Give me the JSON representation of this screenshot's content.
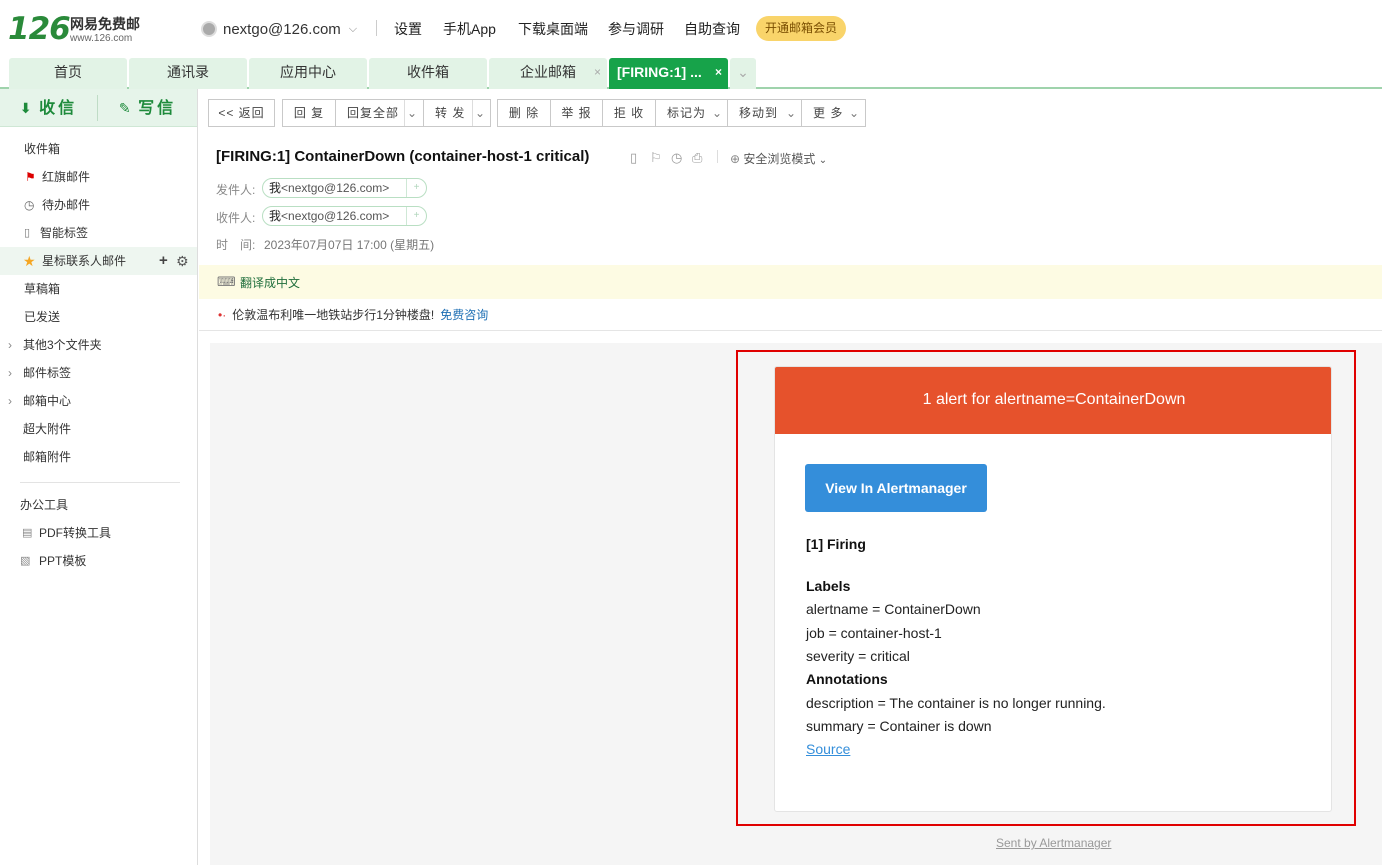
{
  "header": {
    "logo_number": "126",
    "logo_name": "网易免费邮",
    "logo_domain": "www.126.com",
    "account": "nextgo@126.com",
    "links": [
      "设置",
      "手机App",
      "下载桌面端",
      "参与调研",
      "自助查询"
    ],
    "vip_label": "开通邮箱会员"
  },
  "tabs": [
    {
      "label": "首页"
    },
    {
      "label": "通讯录"
    },
    {
      "label": "应用中心"
    },
    {
      "label": "收件箱"
    },
    {
      "label": "企业邮箱",
      "close": "×"
    },
    {
      "label": "[FIRING:1] ...",
      "close": "×"
    }
  ],
  "tab_more": "⌄",
  "sidebar": {
    "receive_label": "收信",
    "write_label": "写信",
    "items": [
      {
        "label": "收件箱"
      },
      {
        "label": "红旗邮件"
      },
      {
        "label": "待办邮件"
      },
      {
        "label": "智能标签"
      },
      {
        "label": "星标联系人邮件"
      },
      {
        "label": "草稿箱"
      },
      {
        "label": "已发送"
      },
      {
        "label": "其他3个文件夹"
      },
      {
        "label": "邮件标签"
      },
      {
        "label": "邮箱中心"
      },
      {
        "label": "超大附件"
      },
      {
        "label": "邮箱附件"
      }
    ],
    "tools_title": "办公工具",
    "tools": [
      {
        "label": "PDF转换工具"
      },
      {
        "label": "PPT模板"
      }
    ]
  },
  "toolbar": {
    "back": "<< 返回",
    "reply": "回 复",
    "reply_all": "回复全部",
    "forward": "转 发",
    "delete": "删 除",
    "report": "举 报",
    "reject": "拒 收",
    "mark_as": "标记为",
    "move_to": "移动到",
    "more": "更 多"
  },
  "mail": {
    "subject": "[FIRING:1] ContainerDown (container-host-1 critical)",
    "safe_mode": "安全浏览模式",
    "from_label": "发件人:",
    "to_label": "收件人:",
    "time_label": "时　间:",
    "sender_me": "我",
    "sender_email": "<nextgo@126.com>",
    "recipient_me": "我",
    "recipient_email": "<nextgo@126.com>",
    "time": "2023年07月07日 17:00 (星期五)",
    "translate": "翻译成中文",
    "ad_text": "伦敦温布利唯一地铁站步行1分钟楼盘!",
    "ad_link": "免费咨询"
  },
  "alert": {
    "header": "1 alert for alertname=ContainerDown",
    "button": "View In Alertmanager",
    "firing": "[1] Firing",
    "labels_title": "Labels",
    "labels": [
      "alertname = ContainerDown",
      "job = container-host-1",
      "severity = critical"
    ],
    "annotations_title": "Annotations",
    "annotations": [
      "description = The container is no longer running.",
      "summary = Container is down"
    ],
    "source": "Source",
    "sent_by": "Sent by Alertmanager"
  },
  "colors": {
    "brand_green": "#17a34a",
    "alert_header": "#e6522c",
    "alert_button": "#348eda",
    "highlight_box": "#e00000"
  }
}
